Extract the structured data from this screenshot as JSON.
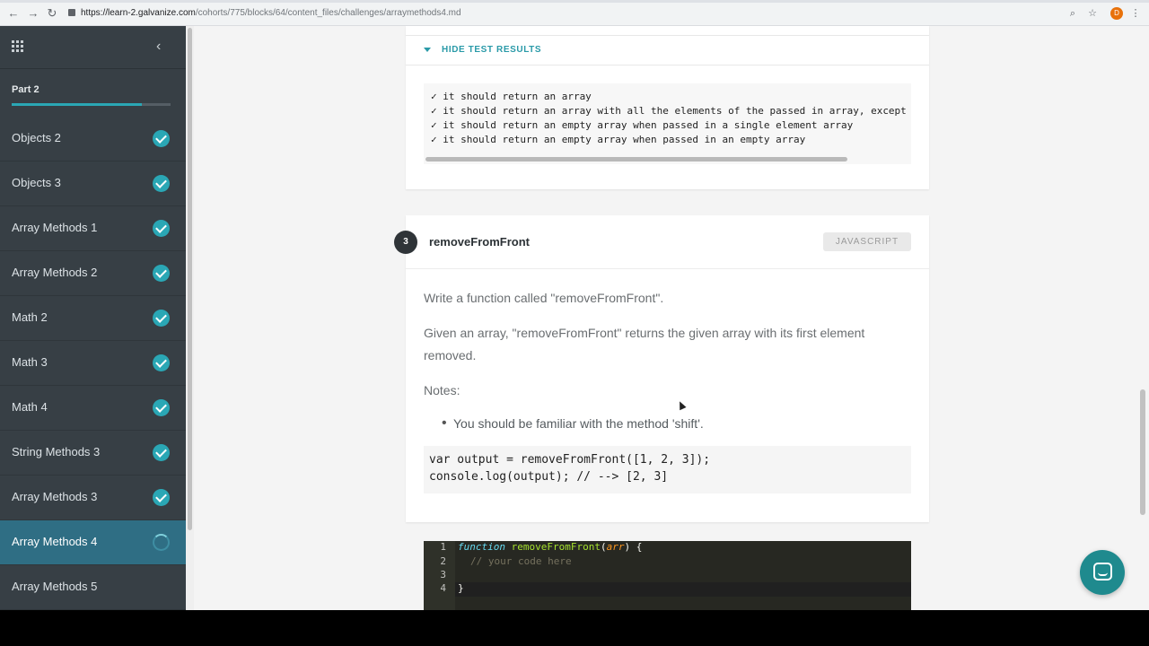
{
  "browser": {
    "url_host": "https://learn-2.galvanize.com",
    "url_path": "/cohorts/775/blocks/64/content_files/challenges/arraymethods4.md",
    "profile_initial": "D"
  },
  "sidebar": {
    "part_title": "Part 2",
    "progress_fraction": 0.82,
    "items": [
      {
        "label": "Objects 2",
        "status": "complete"
      },
      {
        "label": "Objects 3",
        "status": "complete"
      },
      {
        "label": "Array Methods 1",
        "status": "complete"
      },
      {
        "label": "Array Methods 2",
        "status": "complete"
      },
      {
        "label": "Math 2",
        "status": "complete"
      },
      {
        "label": "Math 3",
        "status": "complete"
      },
      {
        "label": "Math 4",
        "status": "complete"
      },
      {
        "label": "String Methods 3",
        "status": "complete"
      },
      {
        "label": "Array Methods 3",
        "status": "complete"
      },
      {
        "label": "Array Methods 4",
        "status": "in-progress"
      },
      {
        "label": "Array Methods 5",
        "status": "none"
      }
    ]
  },
  "results": {
    "toggle_label": "HIDE TEST RESULTS",
    "lines": [
      "✓ it should return an array",
      "✓ it should return an array with all the elements of the passed in array, except f",
      "✓ it should return an empty array when passed in a single element array",
      "✓ it should return an empty array when passed in an empty array"
    ]
  },
  "challenge": {
    "number": "3",
    "title": "removeFromFront",
    "language": "JAVASCRIPT",
    "para1": "Write a function called \"removeFromFront\".",
    "para2": "Given an array, \"removeFromFront\" returns the given array with its first element removed.",
    "notes_label": "Notes:",
    "bullet": "You should be familiar with the method 'shift'.",
    "code_line1": "var output = removeFromFront([1, 2, 3]);",
    "code_line2": "console.log(output); // --> [2, 3]"
  },
  "editor": {
    "line_numbers": [
      "1",
      "2",
      "3",
      "4"
    ],
    "kw": "function",
    "fn_name": "removeFromFront",
    "arg": "arr",
    "comment": "// your code here",
    "close": "}"
  },
  "colors": {
    "sidebar_bg": "#373f45",
    "accent": "#2aa7b5",
    "active_item": "#2f6e84",
    "chat": "#1f8a8e"
  }
}
